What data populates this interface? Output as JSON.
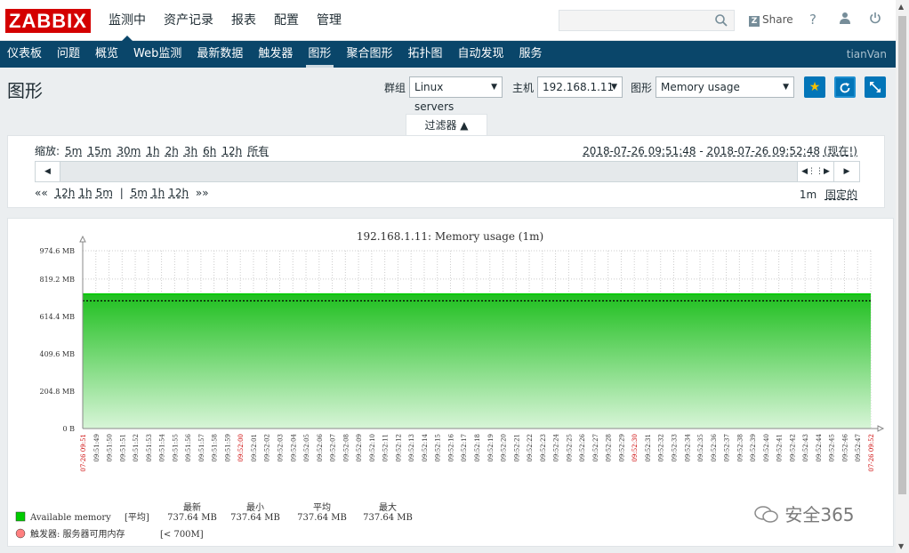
{
  "app": {
    "logo": "ZABBIX",
    "share": "Share",
    "user": "tianVan"
  },
  "main_menu": [
    {
      "label": "监测中",
      "active": true
    },
    {
      "label": "资产记录",
      "active": false
    },
    {
      "label": "报表",
      "active": false
    },
    {
      "label": "配置",
      "active": false
    },
    {
      "label": "管理",
      "active": false
    }
  ],
  "sub_menu": [
    {
      "label": "仪表板",
      "active": false
    },
    {
      "label": "问题",
      "active": false
    },
    {
      "label": "概览",
      "active": false
    },
    {
      "label": "Web监测",
      "active": false
    },
    {
      "label": "最新数据",
      "active": false
    },
    {
      "label": "触发器",
      "active": false
    },
    {
      "label": "图形",
      "active": true
    },
    {
      "label": "聚合图形",
      "active": false
    },
    {
      "label": "拓扑图",
      "active": false
    },
    {
      "label": "自动发现",
      "active": false
    },
    {
      "label": "服务",
      "active": false
    }
  ],
  "header": {
    "title": "图形",
    "group_label": "群组",
    "group_value": "Linux servers",
    "host_label": "主机",
    "host_value": "192.168.1.11",
    "graph_label": "图形",
    "graph_value": "Memory usage"
  },
  "filter": {
    "tab_label": "过滤器 ▲",
    "zoom_label": "缩放:",
    "zoom_options": [
      "5m",
      "15m",
      "30m",
      "1h",
      "2h",
      "3h",
      "6h",
      "12h",
      "所有"
    ],
    "range_from": "2018-07-26 09:51:48",
    "range_to": "2018-07-26 09:52:48",
    "range_now": "(现在!)",
    "nav_back": [
      "12h",
      "1h",
      "5m"
    ],
    "nav_fwd": [
      "5m",
      "1h",
      "12h"
    ],
    "period": "1m",
    "fixed_label": "固定的"
  },
  "chart_data": {
    "type": "area",
    "title": "192.168.1.11: Memory usage (1m)",
    "y_ticks": [
      "0 B",
      "204.8 MB",
      "409.6 MB",
      "614.4 MB",
      "819.2 MB",
      "974.6 MB"
    ],
    "ylim": [
      0,
      974.6
    ],
    "y_unit": "MB",
    "x_ticks": [
      "07-26 09:51",
      "09:51:49",
      "09:51:50",
      "09:51:51",
      "09:51:52",
      "09:51:53",
      "09:51:54",
      "09:51:55",
      "09:51:56",
      "09:51:57",
      "09:51:58",
      "09:51:59",
      "09:52:00",
      "09:52:01",
      "09:52:02",
      "09:52:03",
      "09:52:04",
      "09:52:05",
      "09:52:06",
      "09:52:07",
      "09:52:08",
      "09:52:09",
      "09:52:10",
      "09:52:11",
      "09:52:12",
      "09:52:13",
      "09:52:14",
      "09:52:15",
      "09:52:16",
      "09:52:17",
      "09:52:18",
      "09:52:19",
      "09:52:20",
      "09:52:21",
      "09:52:22",
      "09:52:23",
      "09:52:24",
      "09:52:25",
      "09:52:26",
      "09:52:27",
      "09:52:28",
      "09:52:29",
      "09:52:30",
      "09:52:31",
      "09:52:32",
      "09:52:33",
      "09:52:34",
      "09:52:35",
      "09:52:36",
      "09:52:37",
      "09:52:38",
      "09:52:39",
      "09:52:40",
      "09:52:41",
      "09:52:42",
      "09:52:43",
      "09:52:44",
      "09:52:45",
      "09:52:46",
      "09:52:47",
      "07-26 09:52"
    ],
    "x_tick_highlight": [
      "07-26 09:51",
      "09:52:00",
      "09:52:30",
      "07-26 09:52"
    ],
    "series": [
      {
        "name": "Available memory",
        "values": [
          737.64,
          737.64
        ],
        "color": "#00cc00"
      }
    ],
    "trigger": {
      "name": "触发器: 服务器可用内存",
      "threshold_label": "[< 700M]",
      "value": 700,
      "color": "#ff8080"
    },
    "legend_headers": [
      "最新",
      "最小",
      "平均",
      "最大"
    ],
    "legend_func": "[平均]",
    "legend_values": [
      "737.64 MB",
      "737.64 MB",
      "737.64 MB",
      "737.64 MB"
    ]
  },
  "watermark": "安全365",
  "colors": {
    "accent": "#0275b8",
    "nav_bg": "#0a466a",
    "logo_red": "#d40000"
  }
}
